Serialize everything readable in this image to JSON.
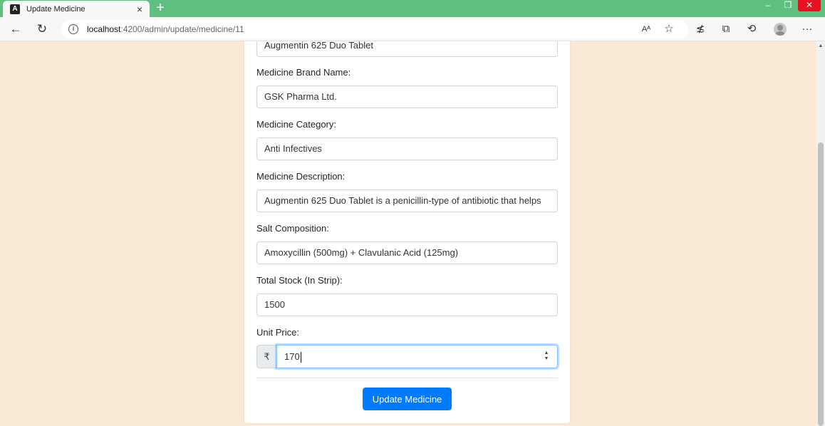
{
  "browser": {
    "tab_title": "Update Medicine",
    "tab_close": "×",
    "new_tab": "+",
    "url_host": "localhost",
    "url_path": ":4200/admin/update/medicine/11"
  },
  "form": {
    "name_value": "Augmentin 625 Duo Tablet",
    "brand_label": "Medicine Brand Name:",
    "brand_value": "GSK Pharma Ltd.",
    "category_label": "Medicine Category:",
    "category_value": "Anti Infectives",
    "description_label": "Medicine Description:",
    "description_value": "Augmentin 625 Duo Tablet is a penicillin-type of antibiotic that helps",
    "salt_label": "Salt Composition:",
    "salt_value": "Amoxycillin (500mg) + Clavulanic Acid (125mg)",
    "stock_label": "Total Stock (In Strip):",
    "stock_value": "1500",
    "price_label": "Unit Price:",
    "price_currency": "₹",
    "price_value": "170",
    "submit_label": "Update Medicine"
  },
  "colors": {
    "page_background": "#fae9d5",
    "titlebar": "#5fbf7f",
    "primary_button": "#007bff"
  },
  "icons": [
    "angular-logo-icon",
    "back-icon",
    "reload-icon",
    "info-icon",
    "read-aloud-icon",
    "favorite-add-icon",
    "favorites-icon",
    "collections-icon",
    "history-icon",
    "profile-icon",
    "more-icon"
  ]
}
